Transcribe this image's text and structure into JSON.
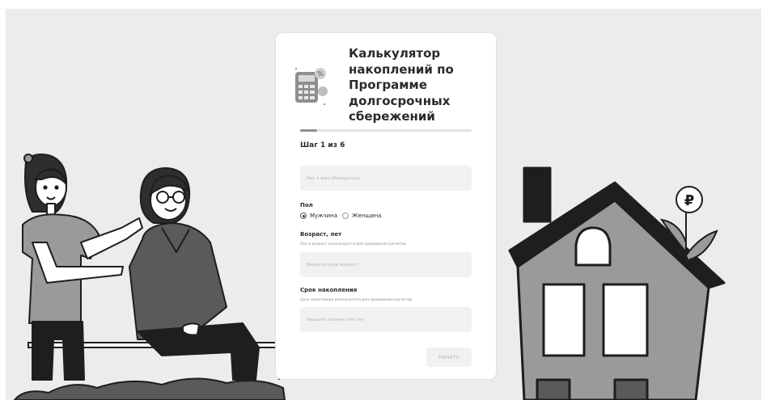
{
  "calculator": {
    "title": "Калькулятор накоплений по Программе долгосрочных сбережений",
    "progress_fraction": 0.1,
    "step_label": "Шаг 1 из 6",
    "name_field": {
      "placeholder": "Как к вам обращаться",
      "value": ""
    },
    "gender": {
      "label": "Пол",
      "options": [
        {
          "label": "Мужчина",
          "selected": true
        },
        {
          "label": "Женщина",
          "selected": false
        }
      ]
    },
    "age": {
      "label": "Возраст, лет",
      "hint": "Пол и возраст используются для проведения расчетов",
      "placeholder": "Введите свой возраст",
      "value": ""
    },
    "term": {
      "label": "Срок накопления",
      "hint": "Срок накопления используется для проведения расчетов",
      "placeholder": "Введите количество лет",
      "value": ""
    },
    "start_button_label": "Начать"
  },
  "illustration": {
    "coin_symbol": "₽"
  },
  "colors": {
    "background": "#ececec",
    "card": "#ffffff",
    "input_bg": "#f1f1f1",
    "text": "#2b2b2b"
  }
}
